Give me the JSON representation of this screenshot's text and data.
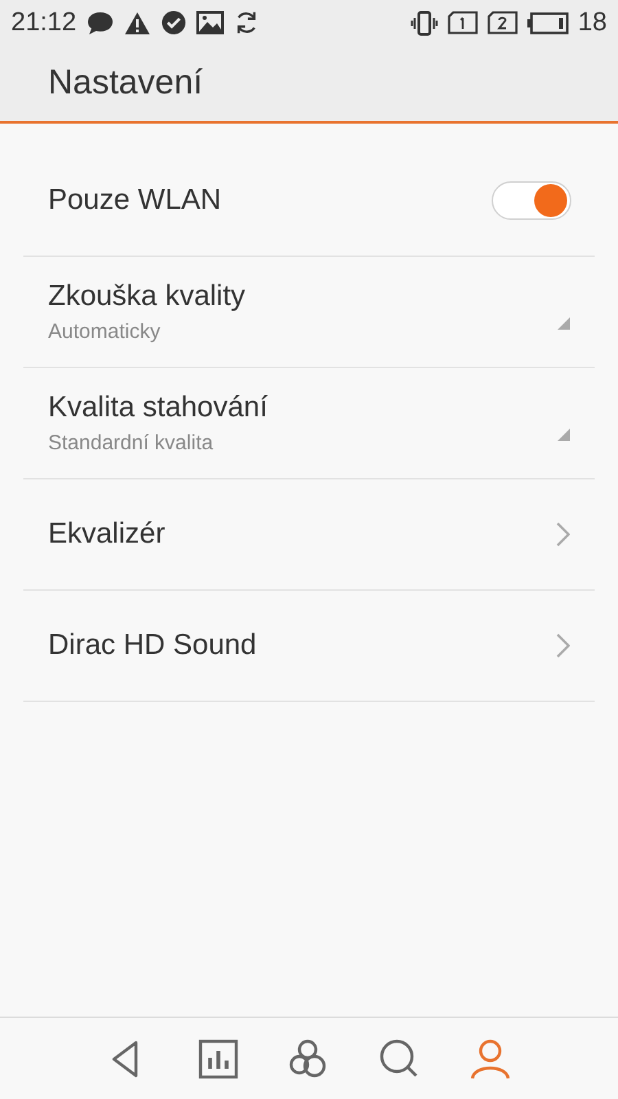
{
  "status_bar": {
    "time": "21:12",
    "battery": "18"
  },
  "header": {
    "title": "Nastavení"
  },
  "settings": [
    {
      "kind": "toggle",
      "label": "Pouze WLAN",
      "on": true
    },
    {
      "kind": "dropdown",
      "label": "Zkouška kvality",
      "value": "Automaticky"
    },
    {
      "kind": "dropdown",
      "label": "Kvalita stahování",
      "value": "Standardní kvalita"
    },
    {
      "kind": "link",
      "label": "Ekvalizér"
    },
    {
      "kind": "link",
      "label": "Dirac HD Sound"
    }
  ],
  "bottom_nav": [
    {
      "selected": false
    },
    {
      "selected": false
    },
    {
      "selected": false
    },
    {
      "selected": false
    },
    {
      "selected": true
    }
  ]
}
